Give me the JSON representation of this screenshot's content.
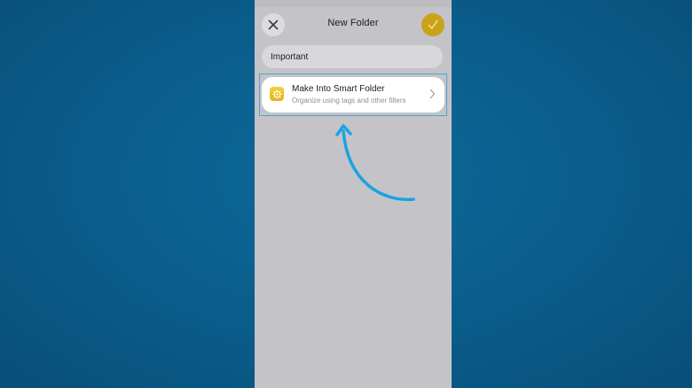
{
  "header": {
    "title": "New Folder",
    "close_icon": "close-icon",
    "done_icon": "checkmark-icon",
    "accent_color": "#caa21a"
  },
  "folder_name": {
    "value": "Important"
  },
  "smart_folder": {
    "title": "Make Into Smart Folder",
    "subtitle": "Organize using tags and other filters",
    "icon": "gear-icon",
    "chevron_icon": "chevron-right-icon"
  },
  "annotation": {
    "arrow_color": "#1aa3e0",
    "highlight_color": "#4aa6d6"
  }
}
